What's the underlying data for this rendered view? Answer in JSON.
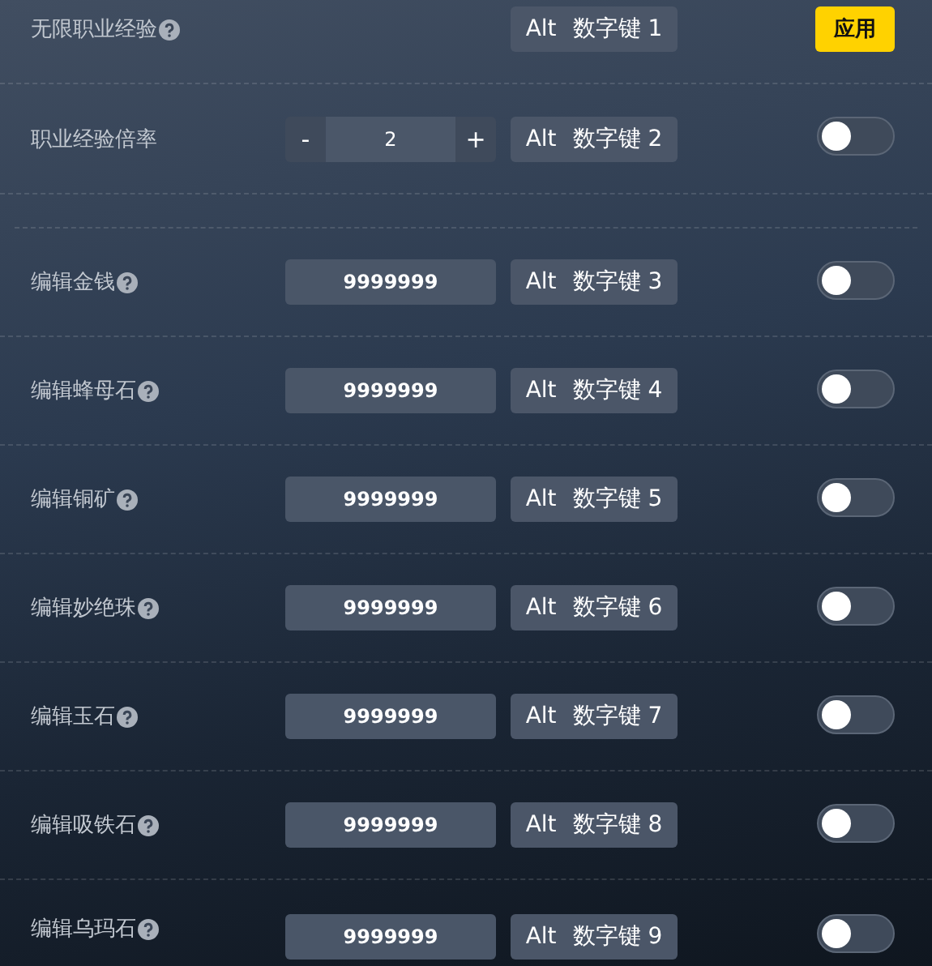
{
  "sections": [
    {
      "rows": [
        {
          "kind": "apply",
          "label": "无限职业经验",
          "help": true,
          "hotkey": {
            "modifier": "Alt",
            "key": "数字键 1"
          },
          "button": "应用"
        },
        {
          "kind": "stepper",
          "label": "职业经验倍率",
          "help": false,
          "stepper": {
            "minus": "-",
            "value": "2",
            "plus": "+"
          },
          "hotkey": {
            "modifier": "Alt",
            "key": "数字键 2"
          },
          "on": false
        }
      ]
    },
    {
      "rows": [
        {
          "kind": "input",
          "label": "编辑金钱",
          "help": true,
          "value": "9999999",
          "hotkey": {
            "modifier": "Alt",
            "key": "数字键 3"
          },
          "on": false
        },
        {
          "kind": "input",
          "label": "编辑蜂母石",
          "help": true,
          "value": "9999999",
          "hotkey": {
            "modifier": "Alt",
            "key": "数字键 4"
          },
          "on": false
        },
        {
          "kind": "input",
          "label": "编辑铜矿",
          "help": true,
          "value": "9999999",
          "hotkey": {
            "modifier": "Alt",
            "key": "数字键 5"
          },
          "on": false
        },
        {
          "kind": "input",
          "label": "编辑妙绝珠",
          "help": true,
          "value": "9999999",
          "hotkey": {
            "modifier": "Alt",
            "key": "数字键 6"
          },
          "on": false
        },
        {
          "kind": "input",
          "label": "编辑玉石",
          "help": true,
          "value": "9999999",
          "hotkey": {
            "modifier": "Alt",
            "key": "数字键 7"
          },
          "on": false
        },
        {
          "kind": "input",
          "label": "编辑吸铁石",
          "help": true,
          "value": "9999999",
          "hotkey": {
            "modifier": "Alt",
            "key": "数字键 8"
          },
          "on": false
        },
        {
          "kind": "input",
          "label": "编辑乌玛石",
          "help": true,
          "value": "9999999",
          "hotkey": {
            "modifier": "Alt",
            "key": "数字键 9"
          },
          "on": false
        }
      ]
    }
  ]
}
